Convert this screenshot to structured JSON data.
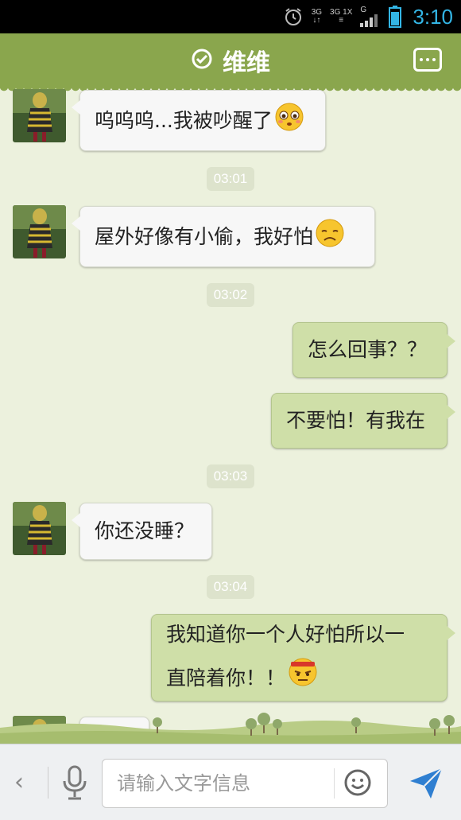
{
  "status_bar": {
    "network_labels": [
      "3G",
      "3G 1X",
      "G"
    ],
    "time": "3:10"
  },
  "header": {
    "title": "维维",
    "verified_icon": "check-circle-icon",
    "menu_icon": "more-dots-icon"
  },
  "messages": [
    {
      "dir": "in",
      "text": "呜呜呜...我被吵醒了",
      "emoji": "pleading-face"
    },
    {
      "dir": "time",
      "text": "03:01"
    },
    {
      "dir": "in",
      "text": "屋外好像有小偷，我好怕",
      "emoji": "sad-face"
    },
    {
      "dir": "time",
      "text": "03:02"
    },
    {
      "dir": "out",
      "text": "怎么回事？？"
    },
    {
      "dir": "out",
      "text": "不要怕！有我在"
    },
    {
      "dir": "time",
      "text": "03:03"
    },
    {
      "dir": "in",
      "text": "你还没睡？"
    },
    {
      "dir": "time",
      "text": "03:04"
    },
    {
      "dir": "out",
      "lines": [
        "我知道你一个人好怕所以一",
        "直陪着你！！"
      ],
      "emoji": "determined-face"
    }
  ],
  "input_bar": {
    "back_icon": "chevron-left-icon",
    "voice_icon": "microphone-icon",
    "placeholder": "请输入文字信息",
    "emoji_icon": "smiley-icon",
    "send_icon": "send-arrow-icon"
  },
  "colors": {
    "header_bg": "#8aa64d",
    "chat_bg": "#ecf1dd",
    "outgoing_bubble": "#cfdfa8",
    "incoming_bubble": "#f7f7f7",
    "status_time": "#33b5e5"
  }
}
